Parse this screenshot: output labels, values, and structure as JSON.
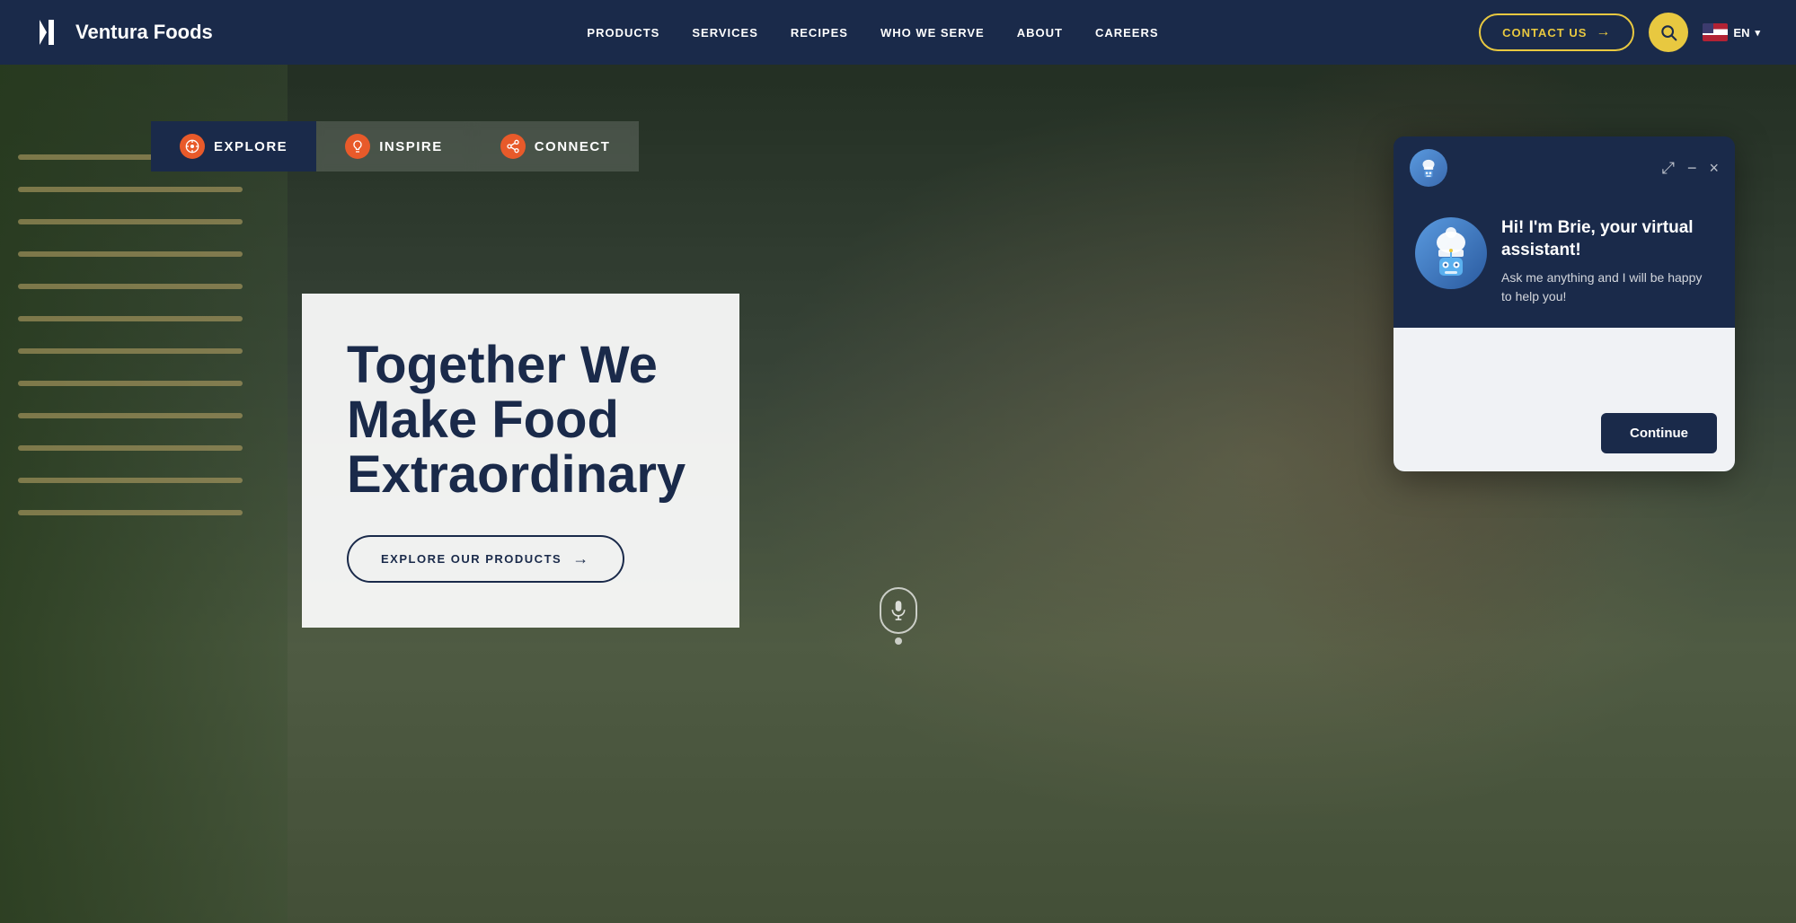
{
  "brand": {
    "name": "Ventura Foods",
    "logo_symbol": "▶"
  },
  "nav": {
    "links": [
      {
        "id": "products",
        "label": "PRODUCTS"
      },
      {
        "id": "services",
        "label": "SERVICES"
      },
      {
        "id": "recipes",
        "label": "RECIPES"
      },
      {
        "id": "who-we-serve",
        "label": "WHO WE SERVE"
      },
      {
        "id": "about",
        "label": "ABOUT"
      },
      {
        "id": "careers",
        "label": "CAREERS"
      }
    ],
    "contact_btn": "CONTACT US",
    "search_icon": "🔍",
    "lang": "EN",
    "lang_icon": "🇺🇸"
  },
  "tabs": [
    {
      "id": "explore",
      "label": "EXPLORE",
      "icon": "⊙",
      "active": true
    },
    {
      "id": "inspire",
      "label": "INSPIRE",
      "icon": "💡",
      "active": false
    },
    {
      "id": "connect",
      "label": "CONNECT",
      "icon": "⟳",
      "active": false
    }
  ],
  "hero": {
    "title_line1": "Together We",
    "title_line2": "Make Food",
    "title_line3": "Extraordinary",
    "explore_btn": "EXPLORE OUR PRODUCTS"
  },
  "chatbot": {
    "header_icon": "🤖",
    "mascot_icon": "🤖",
    "greeting": "Hi! I'm Brie, your virtual assistant!",
    "subtext": "Ask me anything and I will be happy to help you!",
    "continue_btn": "Continue",
    "expand_icon": "⤢",
    "minimize_icon": "−",
    "close_icon": "×"
  }
}
